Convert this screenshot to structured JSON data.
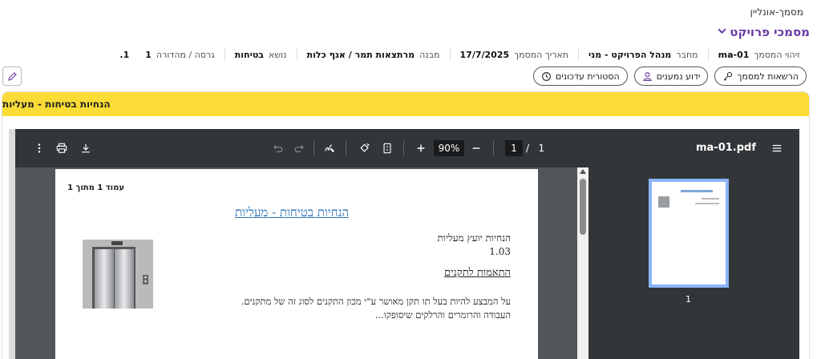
{
  "breadcrumb": "מסמך-אונליין",
  "title": "מסמכי פרויקט",
  "meta": [
    {
      "label": "זיהוי המסמך",
      "value": "ma-01"
    },
    {
      "label": "מחבר",
      "value": "מנהל הפרויקט - מני"
    },
    {
      "label": "תאריך המסמך",
      "value": "17/7/2025"
    },
    {
      "label": "מבנה",
      "value": "מרתצאות תמר / אגף כלות"
    },
    {
      "label": "נושא",
      "value": "בטיחות"
    },
    {
      "label": "גרסה / מהדורה",
      "value": "1",
      "value2": "1."
    }
  ],
  "actions": {
    "permissions": "הרשאות למסמך",
    "stakeholders": "ידוע נמענים",
    "history": "הסטורית עדכונים"
  },
  "section_title": "הנחיות בטיחות - מעליות",
  "viewer": {
    "filename": "ma-01.pdf",
    "page_current": "1",
    "page_total": "1",
    "page_sep": "/",
    "zoom": "90%",
    "thumb_number": "1"
  },
  "pdf": {
    "page_label": "עמוד 1 מתוך 1",
    "doc_title": "הנחיות בטיחות - מעליות",
    "subtitle_line1": "הנחיות יועץ מעליות",
    "subtitle_line2": "1.03",
    "section_heading": "התאמות לתקנים",
    "para_line1": "על המבצע להיות בעל תו תקן מאושר ע\"י מכון התקנים לסוג זה של מתקנים.",
    "para_line2": "העבודה והרומרים והרלקים שיסופקו..."
  },
  "icons": {
    "chevron": "chevron-down-icon",
    "edit": "pencil-icon",
    "key": "key-icon",
    "person": "person-icon",
    "history": "history-icon"
  },
  "colors": {
    "accent": "#6b3aa3",
    "section_header": "#fbdc37",
    "viewer_toolbar": "#323639",
    "viewer_bg": "#525659"
  }
}
